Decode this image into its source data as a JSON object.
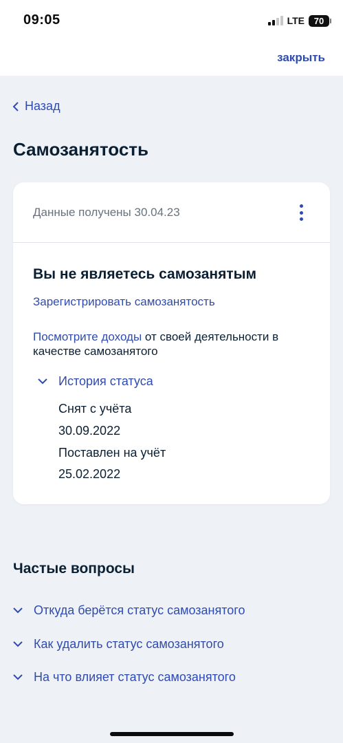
{
  "status_bar": {
    "time": "09:05",
    "network": "LTE",
    "battery": "70"
  },
  "top_bar": {
    "close_label": "закрыть"
  },
  "nav": {
    "back_label": "Назад"
  },
  "page": {
    "title": "Самозанятость"
  },
  "card": {
    "received_text": "Данные получены 30.04.23",
    "status_title": "Вы не являетесь самозанятым",
    "register_link": "Зарегистрировать самозанятость",
    "income_link": "Посмотрите доходы",
    "income_rest": " от своей деятельности в качестве самозанятого",
    "history": {
      "toggle_label": "История статуса",
      "entries": [
        {
          "status": "Снят с учёта",
          "date": "30.09.2022"
        },
        {
          "status": "Поставлен на учёт",
          "date": "25.02.2022"
        }
      ]
    }
  },
  "faq": {
    "title": "Частые вопросы",
    "items": [
      "Откуда берётся статус самозанятого",
      "Как удалить статус самозанятого",
      "На что влияет статус самозанятого"
    ]
  },
  "colors": {
    "accent": "#2f4bb0",
    "background": "#eef2f7",
    "text": "#0b1f33",
    "muted": "#66727f"
  },
  "icons": [
    "back-chevron-icon",
    "kebab-menu-icon",
    "chevron-down-icon"
  ]
}
